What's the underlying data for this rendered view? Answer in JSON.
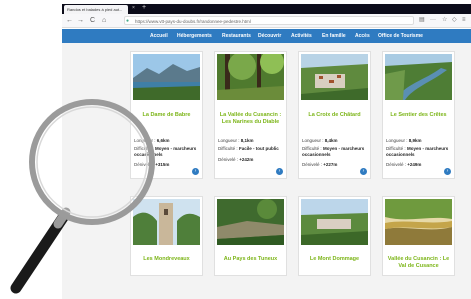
{
  "browser": {
    "tab_title": "Randos et balades à pied aut...",
    "tab_close": "×",
    "new_tab": "+",
    "url": "https://www.vtt-pays-du-doubs.fr/randonnee-pedestre.html",
    "nav": {
      "back": "←",
      "forward": "→",
      "reload": "C",
      "home": "⌂"
    },
    "tools": {
      "reader": "▤",
      "more": "···",
      "bookmark": "☆",
      "shield": "◇",
      "menu": "≡"
    }
  },
  "site_nav": {
    "items": [
      "Accueil",
      "Hébergements",
      "Restaurants",
      "Découvrir",
      "Activités",
      "En famille",
      "Accès",
      "Office de Tourisme"
    ]
  },
  "cards": [
    {
      "title": "La Dame de Babre",
      "length_label": "Longueur :",
      "length": "6,6km",
      "difficulty_label": "Difficulté :",
      "difficulty": "Moyen - marcheurs occasionnels",
      "climb_label": "Dénivelé :",
      "climb": "+315m"
    },
    {
      "title": "La Vallée du Cusancin : Les Narines du Diable",
      "length_label": "Longueur :",
      "length": "8,1km",
      "difficulty_label": "Difficulté :",
      "difficulty": "Facile - tout public",
      "climb_label": "Dénivelé :",
      "climb": "+242m"
    },
    {
      "title": "La Croix de Châtard",
      "length_label": "Longueur :",
      "length": "8,4km",
      "difficulty_label": "Difficulté :",
      "difficulty": "Moyen - marcheurs occasionnels",
      "climb_label": "Dénivelé :",
      "climb": "+227m"
    },
    {
      "title": "Le Sentier des Crêtes",
      "length_label": "Longueur :",
      "length": "8,9km",
      "difficulty_label": "Difficulté :",
      "difficulty": "Moyen - marcheurs occasionnels",
      "climb_label": "Dénivelé :",
      "climb": "+249m"
    },
    {
      "title": "Les Mondreveaux"
    },
    {
      "title": "Au Pays des Tuneux"
    },
    {
      "title": "Le Mont Dommage"
    },
    {
      "title": "Vallée du Cusancin : Le Val de Cusance"
    }
  ],
  "arrow_glyph": "›",
  "colors": {
    "nav_blue": "#2f7bc1",
    "title_green": "#7cb518",
    "tab_strip": "#0c0c1a"
  }
}
